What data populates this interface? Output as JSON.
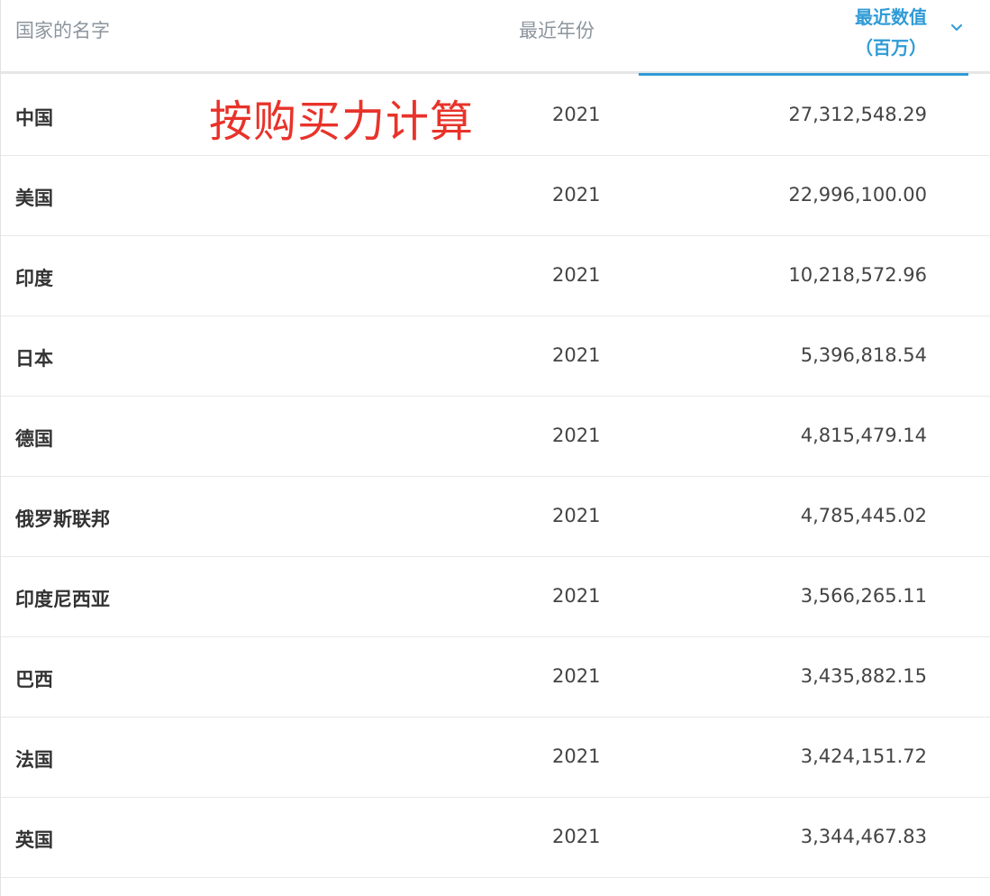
{
  "header": {
    "country_label": "国家的名字",
    "year_label": "最近年份",
    "value_label_line1": "最近数值",
    "value_label_line2": "（百万）"
  },
  "annotation": "按购买力计算",
  "accent_color": "#2f9bd6",
  "annotation_color": "#e8332a",
  "rows": [
    {
      "country": "中国",
      "year": "2021",
      "value": "27,312,548.29"
    },
    {
      "country": "美国",
      "year": "2021",
      "value": "22,996,100.00"
    },
    {
      "country": "印度",
      "year": "2021",
      "value": "10,218,572.96"
    },
    {
      "country": "日本",
      "year": "2021",
      "value": "5,396,818.54"
    },
    {
      "country": "德国",
      "year": "2021",
      "value": "4,815,479.14"
    },
    {
      "country": "俄罗斯联邦",
      "year": "2021",
      "value": "4,785,445.02"
    },
    {
      "country": "印度尼西亚",
      "year": "2021",
      "value": "3,566,265.11"
    },
    {
      "country": "巴西",
      "year": "2021",
      "value": "3,435,882.15"
    },
    {
      "country": "法国",
      "year": "2021",
      "value": "3,424,151.72"
    },
    {
      "country": "英国",
      "year": "2021",
      "value": "3,344,467.83"
    }
  ]
}
